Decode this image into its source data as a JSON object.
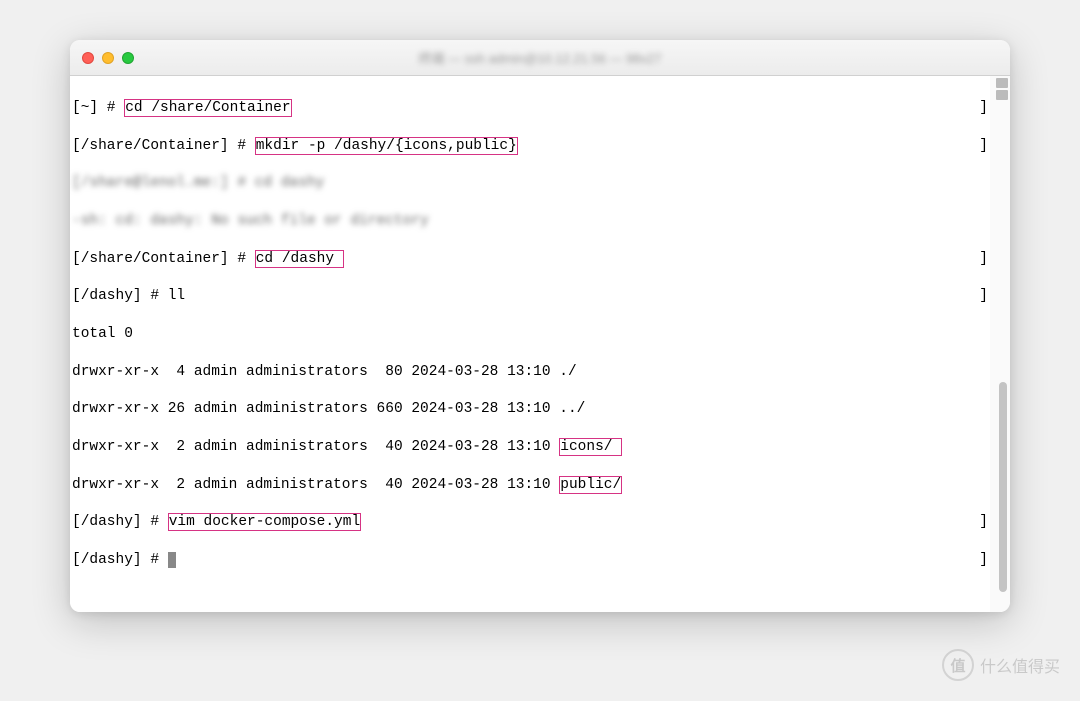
{
  "window": {
    "title": "终端 — ssh admin@10.12.21.56 — 98x27"
  },
  "lines": {
    "l1_prompt_open": "[",
    "l1_path": "[~] #",
    "l1_cmd": "cd /share/Container",
    "l1_close": "]",
    "l2_prompt": "[/share/Container] #",
    "l2_cmd": "mkdir -p /dashy/{icons,public}",
    "l2_close": "]",
    "l3_blur": "[/share@lenol.me:] # cd dashy",
    "l4_blur": "-sh: cd: dashy: No such file or directory",
    "l5_prompt": "[/share/Container] #",
    "l5_cmd": "cd /dashy ",
    "l5_close": "]",
    "l6": "[/dashy] # ll",
    "l6_close": "]",
    "l7": "total 0",
    "l8": "drwxr-xr-x  4 admin administrators  80 2024-03-28 13:10 ./",
    "l9": "drwxr-xr-x 26 admin administrators 660 2024-03-28 13:10 ../",
    "l10_a": "drwxr-xr-x  2 admin administrators  40 2024-03-28 13:10",
    "l10_b": "icons/ ",
    "l11_a": "drwxr-xr-x  2 admin administrators  40 2024-03-28 13:10",
    "l11_b": "public/",
    "l12_prompt": "[/dashy] #",
    "l12_cmd": "vim docker-compose.yml",
    "l12_close": "]",
    "l13": "[/dashy] # ",
    "l13_close": "]"
  },
  "watermark": {
    "badge": "值",
    "text": "什么值得买"
  }
}
